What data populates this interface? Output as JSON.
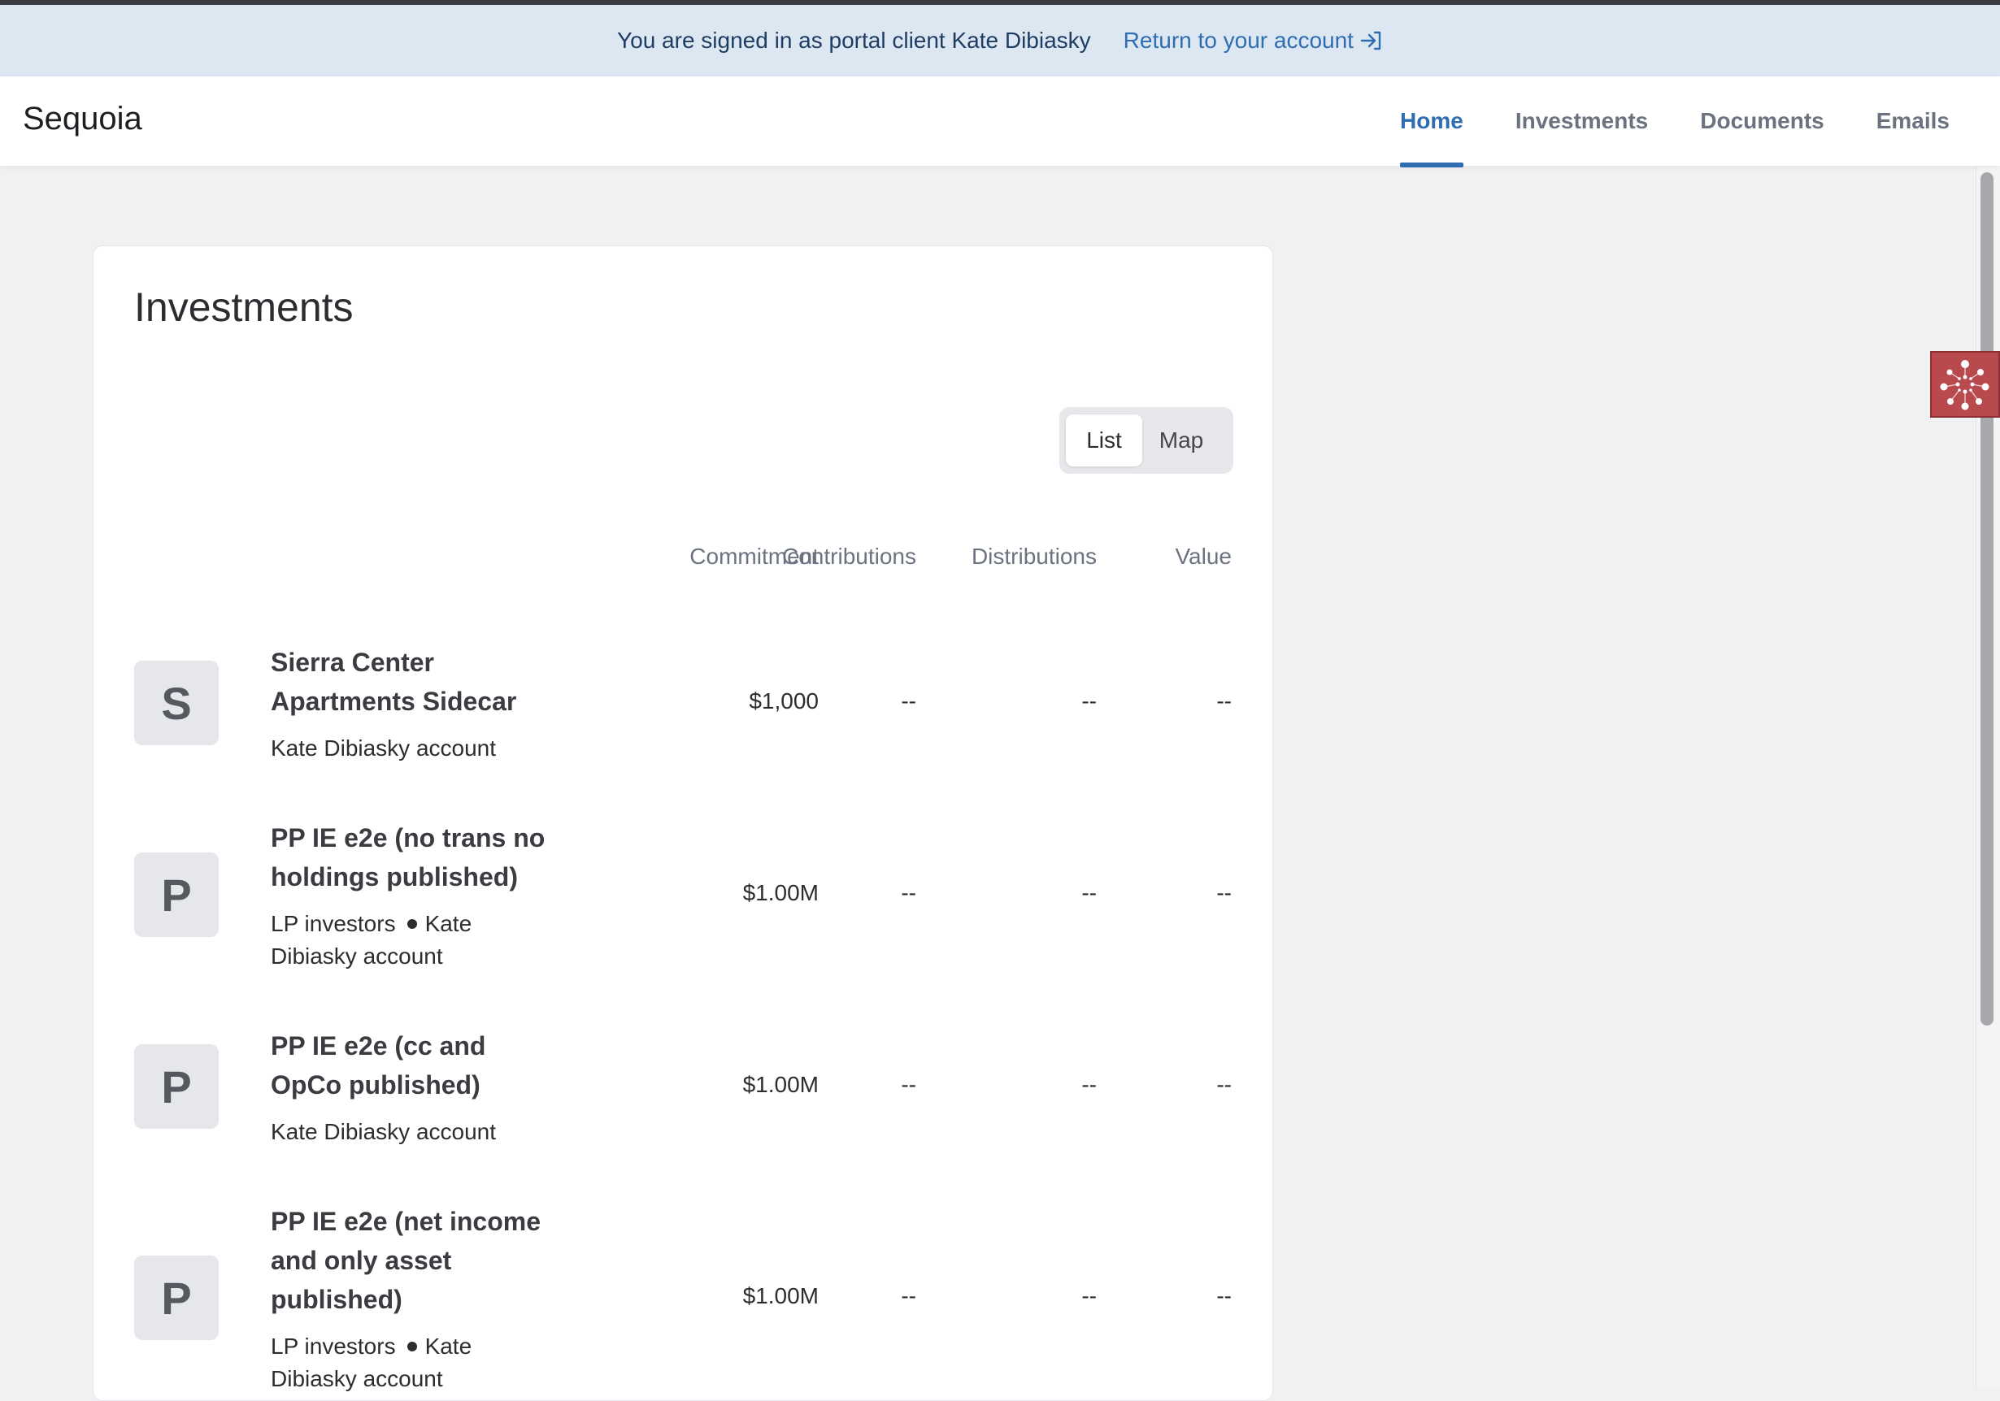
{
  "banner": {
    "message": "You are signed in as portal client Kate Dibiasky",
    "return_link": "Return to your account",
    "return_icon": "sign-in-icon"
  },
  "navbar": {
    "brand": "Sequoia",
    "tabs": [
      {
        "label": "Home",
        "active": true
      },
      {
        "label": "Investments",
        "active": false
      },
      {
        "label": "Documents",
        "active": false
      },
      {
        "label": "Emails",
        "active": false
      }
    ]
  },
  "helper_widget": {
    "icon": "network-dots-icon",
    "color": "#b84a4e"
  },
  "investments": {
    "title": "Investments",
    "view_toggle": {
      "options": [
        "List",
        "Map"
      ],
      "selected": "List"
    },
    "columns": [
      "Commitment",
      "Contributions",
      "Distributions",
      "Value"
    ],
    "rows": [
      {
        "initial": "S",
        "name": "Sierra Center Apartments Sidecar",
        "account_prefix": "",
        "account": "Kate Dibiasky account",
        "commitment": "$1,000",
        "contributions": "--",
        "distributions": "--",
        "value": "--"
      },
      {
        "initial": "P",
        "name": "PP IE e2e (no trans no holdings published)",
        "account_prefix": "LP investors",
        "account": "Kate Dibiasky account",
        "commitment": "$1.00M",
        "contributions": "--",
        "distributions": "--",
        "value": "--"
      },
      {
        "initial": "P",
        "name": "PP IE e2e (cc and OpCo published)",
        "account_prefix": "",
        "account": "Kate Dibiasky account",
        "commitment": "$1.00M",
        "contributions": "--",
        "distributions": "--",
        "value": "--"
      },
      {
        "initial": "P",
        "name": "PP IE e2e (net income and only asset published)",
        "account_prefix": "LP investors",
        "account": "Kate Dibiasky account",
        "commitment": "$1.00M",
        "contributions": "--",
        "distributions": "--",
        "value": "--"
      }
    ]
  },
  "colors": {
    "accent": "#2f6db3",
    "banner_bg": "#dde7f2",
    "page_bg": "#f0f1f3"
  }
}
